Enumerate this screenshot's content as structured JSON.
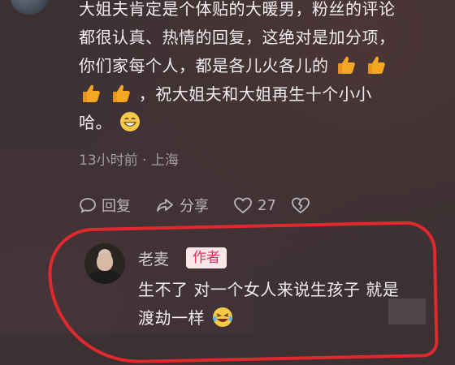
{
  "comment": {
    "line1": "大姐夫肯定是个体贴的大暖男，粉丝的评论",
    "line2": "都很认真、热情的回复，这绝对是加分项，",
    "line3": "你们家每个人，都是各儿火各儿的",
    "line4": "，祝大姐夫和大姐再生十个小小",
    "line5": "哈。",
    "time": "13小时前",
    "separator": " · ",
    "location": "上海",
    "emoji_thumb": "thumbs-up-icon",
    "emoji_grin": "grin-icon"
  },
  "actions": {
    "reply_label": "回复",
    "share_label": "分享",
    "like_count": "27"
  },
  "reply": {
    "author": "老麦",
    "badge": "作者",
    "line1": "生不了 对一个女人来说生孩子 就是",
    "line2": "渡劫一样",
    "emoji": "laughing-tears-icon"
  },
  "colors": {
    "highlight": "#e0282f",
    "badge_text": "#e3335a",
    "badge_bg": "#fbe6ea"
  }
}
